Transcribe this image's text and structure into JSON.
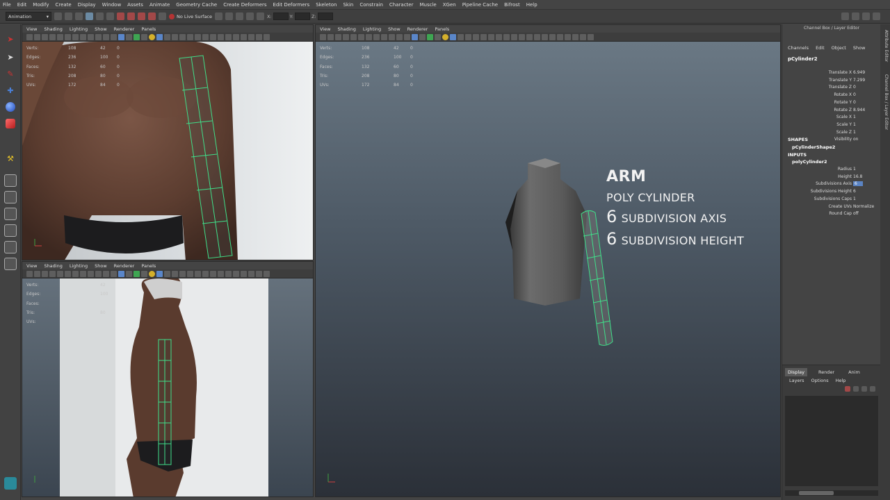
{
  "menubar": {
    "items": [
      "File",
      "Edit",
      "Modify",
      "Create",
      "Display",
      "Window",
      "Assets",
      "Animate",
      "Geometry Cache",
      "Create Deformers",
      "Edit Deformers",
      "Skeleton",
      "Skin",
      "Constrain",
      "Character",
      "Muscle",
      "XGen",
      "Pipeline Cache",
      "Bifrost",
      "Help"
    ]
  },
  "status": {
    "mode": "Animation",
    "live_surface": "No Live Surface",
    "x_label": "X:",
    "y_label": "Y:",
    "z_label": "Z:"
  },
  "panel_menu": [
    "View",
    "Shading",
    "Lighting",
    "Show",
    "Renderer",
    "Panels"
  ],
  "hud": {
    "rows": [
      {
        "label": "Verts:",
        "a": "108",
        "b": "42",
        "c": "0"
      },
      {
        "label": "Edges:",
        "a": "236",
        "b": "100",
        "c": "0"
      },
      {
        "label": "Faces:",
        "a": "132",
        "b": "60",
        "c": "0"
      },
      {
        "label": "Tris:",
        "a": "208",
        "b": "80",
        "c": "0"
      },
      {
        "label": "UVs:",
        "a": "172",
        "b": "84",
        "c": "0"
      }
    ],
    "side_rows": [
      {
        "label": "Verts:",
        "a": "",
        "b": "42",
        "c": ""
      },
      {
        "label": "Edges:",
        "a": "",
        "b": "100",
        "c": ""
      },
      {
        "label": "Faces:",
        "a": "",
        "b": "",
        "c": ""
      },
      {
        "label": "Tris:",
        "a": "",
        "b": "80",
        "c": ""
      },
      {
        "label": "UVs:",
        "a": "",
        "b": "",
        "c": ""
      }
    ]
  },
  "channelbox": {
    "title": "Channel Box / Layer Editor",
    "tabs": [
      "Channels",
      "Edit",
      "Object",
      "Show"
    ],
    "object": "pCylinder2",
    "attrs": [
      {
        "name": "Translate X",
        "value": "6.949"
      },
      {
        "name": "Translate Y",
        "value": "7.299"
      },
      {
        "name": "Translate Z",
        "value": "0"
      },
      {
        "name": "Rotate X",
        "value": "0"
      },
      {
        "name": "Rotate Y",
        "value": "0"
      },
      {
        "name": "Rotate Z",
        "value": "8.944"
      },
      {
        "name": "Scale X",
        "value": "1"
      },
      {
        "name": "Scale Y",
        "value": "1"
      },
      {
        "name": "Scale Z",
        "value": "1"
      },
      {
        "name": "Visibility",
        "value": "on"
      }
    ],
    "shapes_label": "SHAPES",
    "shape_name": "pCylinderShape2",
    "inputs_label": "INPUTS",
    "input_name": "polyCylinder2",
    "input_attrs": [
      {
        "name": "Radius",
        "value": "1"
      },
      {
        "name": "Height",
        "value": "16.8"
      },
      {
        "name": "Subdivisions Axis",
        "value": "6"
      },
      {
        "name": "Subdivisions Height",
        "value": "6"
      },
      {
        "name": "Subdivisions Caps",
        "value": "1"
      },
      {
        "name": "Create UVs",
        "value": "Normalize"
      },
      {
        "name": "Round Cap",
        "value": "off"
      }
    ],
    "layer_tabs": [
      "Display",
      "Render",
      "Anim"
    ],
    "layer_menu": [
      "Layers",
      "Options",
      "Help"
    ]
  },
  "sidetabs": [
    "Attribute Editor",
    "Channel Box / Layer Editor"
  ],
  "overlay": {
    "title": "ARM",
    "line1": "POLY CYLINDER",
    "axis_num": "6",
    "axis_text": "SUBDIVISION AXIS",
    "height_num": "6",
    "height_text": "SUBDIVISION HEIGHT"
  },
  "colors": {
    "wire": "#3fe08a",
    "ui_bg": "#444444",
    "selection": "#5b84c4"
  }
}
